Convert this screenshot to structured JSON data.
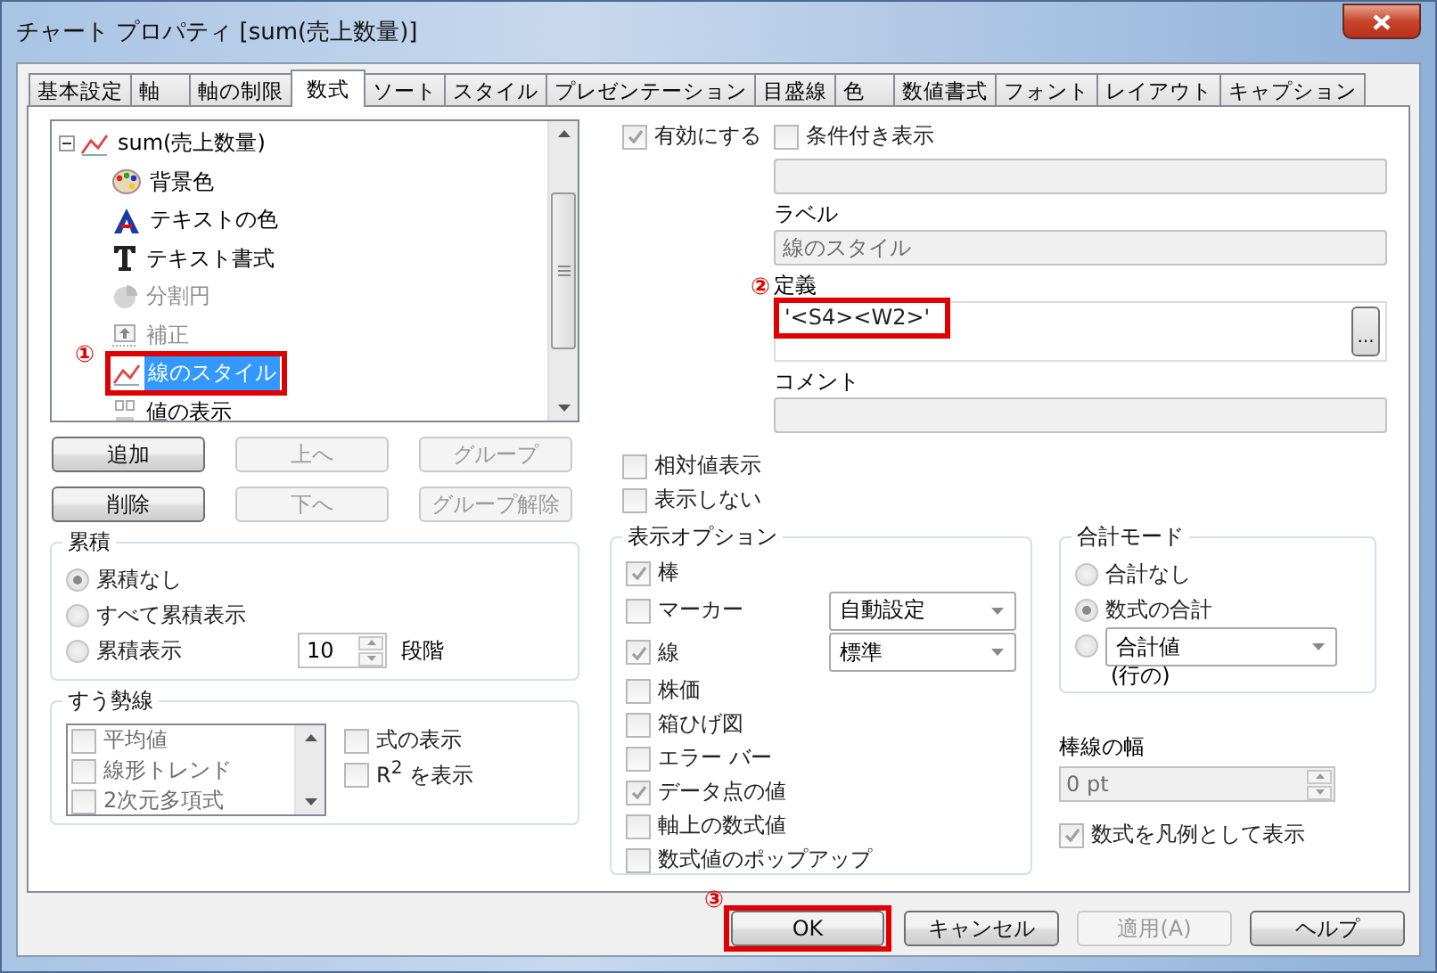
{
  "window": {
    "title": "チャート プロパティ [sum(売上数量)]"
  },
  "tabs": [
    {
      "label": "基本設定",
      "selected": false
    },
    {
      "label": "軸",
      "selected": false
    },
    {
      "label": "軸の制限",
      "selected": false
    },
    {
      "label": "数式",
      "selected": true
    },
    {
      "label": "ソート",
      "selected": false
    },
    {
      "label": "スタイル",
      "selected": false
    },
    {
      "label": "プレゼンテーション",
      "selected": false
    },
    {
      "label": "目盛線",
      "selected": false
    },
    {
      "label": "色",
      "selected": false
    },
    {
      "label": "数値書式",
      "selected": false
    },
    {
      "label": "フォント",
      "selected": false
    },
    {
      "label": "レイアウト",
      "selected": false
    },
    {
      "label": "キャプション",
      "selected": false
    }
  ],
  "expression_tree": {
    "items": [
      {
        "label": "sum(売上数量)",
        "expanded": true,
        "selected": false,
        "children": [
          {
            "kind": "palette",
            "label": "背景色",
            "disabled": false,
            "selected": false
          },
          {
            "kind": "text-color",
            "label": "テキストの色",
            "disabled": false,
            "selected": false
          },
          {
            "kind": "text-format",
            "label": "テキスト書式",
            "disabled": false,
            "selected": false
          },
          {
            "kind": "pie",
            "label": "分割円",
            "disabled": true,
            "selected": false
          },
          {
            "kind": "offset",
            "label": "補正",
            "disabled": true,
            "selected": false
          },
          {
            "kind": "line",
            "label": "線のスタイル",
            "disabled": false,
            "selected": true,
            "callout": "①"
          },
          {
            "kind": "value",
            "label": "値の表示",
            "disabled": false,
            "selected": false
          }
        ]
      }
    ]
  },
  "tree_buttons": [
    {
      "label": "追加",
      "disabled": false
    },
    {
      "label": "上へ",
      "disabled": true
    },
    {
      "label": "グループ",
      "disabled": true
    },
    {
      "label": "削除",
      "disabled": false
    },
    {
      "label": "下へ",
      "disabled": true
    },
    {
      "label": "グループ解除",
      "disabled": true
    }
  ],
  "accumulation": {
    "title": "累積",
    "options": [
      {
        "label": "累積なし",
        "selected": true
      },
      {
        "label": "すべて累積表示",
        "selected": false
      },
      {
        "label": "累積表示",
        "selected": false
      }
    ],
    "steps_value": "10",
    "steps_label": "段階"
  },
  "trendlines": {
    "title": "すう勢線",
    "items": [
      {
        "label": "平均値",
        "checked": false
      },
      {
        "label": "線形トレンド",
        "checked": false
      },
      {
        "label": "2次元多項式",
        "checked": false
      }
    ],
    "options": [
      {
        "label": "式の表示",
        "checked": false
      },
      {
        "label": "R$^{2}$ を表示",
        "checked": false
      }
    ]
  },
  "expression": {
    "enable": {
      "label": "有効にする",
      "checked": true
    },
    "conditional": {
      "label": "条件付き表示",
      "checked": false
    },
    "label_caption": "ラベル",
    "label_value": "線のスタイル",
    "definition_caption": "定義",
    "definition_value": "'<S4><W2>'",
    "definition_callout": "②",
    "definition_button": "...",
    "comment_caption": "コメント"
  },
  "flags": [
    {
      "label": "相対値表示",
      "checked": false
    },
    {
      "label": "表示しない",
      "checked": false
    }
  ],
  "display_options": {
    "title": "表示オプション",
    "items": [
      {
        "kind": "check",
        "label": "棒",
        "checked": true
      },
      {
        "kind": "combo",
        "label": "マーカー",
        "checked": false,
        "value": "自動設定"
      },
      {
        "kind": "combo",
        "label": "線",
        "checked": true,
        "value": "標準"
      },
      {
        "kind": "check",
        "label": "株価",
        "checked": false
      },
      {
        "kind": "check",
        "label": "箱ひげ図",
        "checked": false
      },
      {
        "kind": "check",
        "label": "エラー バー",
        "checked": false
      },
      {
        "kind": "check",
        "label": "データ点の値",
        "checked": true
      },
      {
        "kind": "check",
        "label": "軸上の数式値",
        "checked": false
      },
      {
        "kind": "check",
        "label": "数式値のポップアップ",
        "checked": false
      }
    ]
  },
  "total_mode": {
    "title": "合計モード",
    "options": [
      {
        "kind": "text",
        "label": "合計なし",
        "selected": false
      },
      {
        "kind": "text",
        "label": "数式の合計",
        "selected": true
      },
      {
        "kind": "combo",
        "value": "合計値",
        "caption": "(行の)",
        "selected": false
      }
    ]
  },
  "bar_width": {
    "caption": "棒線の幅",
    "value": "0 pt"
  },
  "legend": {
    "label": "数式を凡例として表示",
    "checked": true
  },
  "buttons": [
    {
      "label": "OK",
      "disabled": false,
      "callout": "③"
    },
    {
      "label": "キャンセル",
      "disabled": false
    },
    {
      "label": "適用(A)",
      "disabled": true
    },
    {
      "label": "ヘルプ",
      "disabled": false
    }
  ]
}
